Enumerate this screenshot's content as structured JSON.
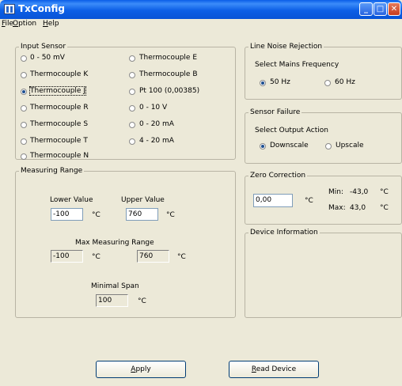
{
  "window": {
    "title": "TxConfig",
    "minimize": "_",
    "maximize": "□",
    "close": "✕"
  },
  "menu": [
    {
      "label": "File",
      "mnemonic": "F",
      "rest": "ile"
    },
    {
      "label": "Option",
      "mnemonic": "O",
      "rest": "ption"
    },
    {
      "label": "Help",
      "mnemonic": "H",
      "rest": "elp"
    }
  ],
  "input_sensor": {
    "title": "Input Sensor",
    "options": [
      {
        "label": "0 - 50 mV",
        "selected": false
      },
      {
        "label": "Thermocouple K",
        "selected": false
      },
      {
        "label": "Thermocouple J",
        "selected": true
      },
      {
        "label": "Thermocouple R",
        "selected": false
      },
      {
        "label": "Thermocouple S",
        "selected": false
      },
      {
        "label": "Thermocouple T",
        "selected": false
      },
      {
        "label": "Thermocouple N",
        "selected": false
      },
      {
        "label": "Thermocouple E",
        "selected": false
      },
      {
        "label": "Thermocouple B",
        "selected": false
      },
      {
        "label": "Pt 100 (0,00385)",
        "selected": false
      },
      {
        "label": "0 - 10 V",
        "selected": false
      },
      {
        "label": "0 - 20 mA",
        "selected": false
      },
      {
        "label": "4 - 20 mA",
        "selected": false
      }
    ]
  },
  "line_noise": {
    "title": "Line Noise Rejection",
    "prompt": "Select Mains Frequency",
    "options": [
      {
        "label": "50 Hz",
        "selected": true
      },
      {
        "label": "60 Hz",
        "selected": false
      }
    ]
  },
  "sensor_failure": {
    "title": "Sensor Failure",
    "prompt": "Select Output Action",
    "options": [
      {
        "label": "Downscale",
        "selected": true
      },
      {
        "label": "Upscale",
        "selected": false
      }
    ]
  },
  "measuring_range": {
    "title": "Measuring Range",
    "lower_label": "Lower Value",
    "lower_value": "-100",
    "upper_label": "Upper Value",
    "upper_value": "760",
    "max_label": "Max Measuring Range",
    "max_lower": "-100",
    "max_upper": "760",
    "span_label": "Minimal Span",
    "span_value": "100",
    "unit": "°C"
  },
  "zero_correction": {
    "title": "Zero Correction",
    "value": "0,00",
    "unit": "°C",
    "min_label": "Min:",
    "min_value": "-43,0",
    "min_unit": "°C",
    "max_label": "Max:",
    "max_value": "43,0",
    "max_unit": "°C"
  },
  "device_info": {
    "title": "Device Information"
  },
  "buttons": {
    "apply": {
      "mnemonic": "A",
      "rest": "pply"
    },
    "read": {
      "mnemonic": "R",
      "rest": "ead Device"
    }
  }
}
